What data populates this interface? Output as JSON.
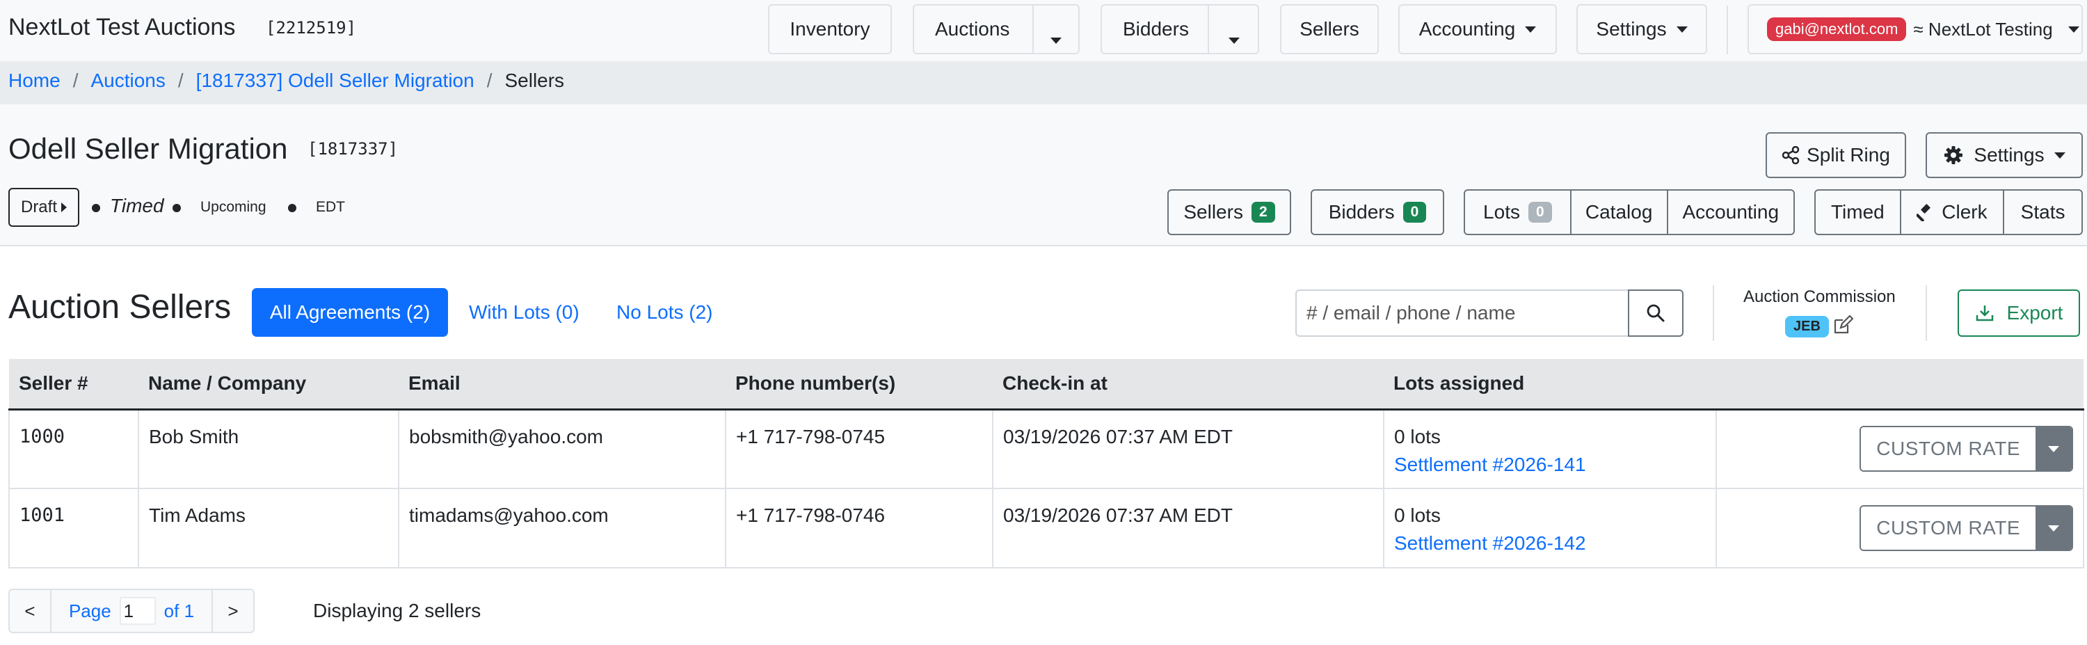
{
  "app": {
    "name": "NextLot Test Auctions",
    "id": "[2212519]"
  },
  "nav": {
    "inventory": "Inventory",
    "auctions": "Auctions",
    "bidders": "Bidders",
    "sellers": "Sellers",
    "accounting": "Accounting",
    "settings": "Settings",
    "user_email": "gabi@nextlot.com",
    "org": "≈ NextLot Testing"
  },
  "breadcrumb": {
    "home": "Home",
    "auctions": "Auctions",
    "auction": "[1817337] Odell Seller Migration",
    "current": "Sellers",
    "sep": "/"
  },
  "auction": {
    "title": "Odell Seller Migration",
    "id": "[1817337]",
    "state": "Draft",
    "format": "Timed",
    "phase": "Upcoming",
    "timezone": "EDT"
  },
  "header_actions": {
    "split_ring": "Split Ring",
    "settings": "Settings",
    "sellers": "Sellers",
    "sellers_count": "2",
    "bidders": "Bidders",
    "bidders_count": "0",
    "lots": "Lots",
    "lots_count": "0",
    "catalog": "Catalog",
    "accounting": "Accounting",
    "timed": "Timed",
    "clerk": "Clerk",
    "stats": "Stats"
  },
  "section": {
    "title": "Auction Sellers",
    "filters": {
      "all": "All Agreements (2)",
      "with_lots": "With Lots (0)",
      "no_lots": "No Lots (2)"
    },
    "search_placeholder": "# / email / phone / name",
    "commission_label": "Auction Commission",
    "commission_code": "JEB",
    "export": "Export"
  },
  "table": {
    "headers": [
      "Seller #",
      "Name / Company",
      "Email",
      "Phone number(s)",
      "Check-in at",
      "Lots assigned"
    ],
    "rows": [
      {
        "seller_no": "1000",
        "name": "Bob Smith",
        "email": "bobsmith@yahoo.com",
        "phone": "+1 717-798-0745",
        "checkin": "03/19/2026 07:37 AM EDT",
        "lots": "0 lots",
        "settlement": "Settlement #2026-141",
        "action": "CUSTOM RATE"
      },
      {
        "seller_no": "1001",
        "name": "Tim Adams",
        "email": "timadams@yahoo.com",
        "phone": "+1 717-798-0746",
        "checkin": "03/19/2026 07:37 AM EDT",
        "lots": "0 lots",
        "settlement": "Settlement #2026-142",
        "action": "CUSTOM RATE"
      }
    ]
  },
  "pager": {
    "prev": "<",
    "page_label": "Page",
    "page_value": "1",
    "of_label": "of 1",
    "next": ">",
    "summary": "Displaying 2 sellers"
  },
  "colors": {
    "primary": "#0d6efd",
    "success": "#198754",
    "danger": "#dc3545",
    "info": "#4fc3f7",
    "secondary": "#6c757d"
  }
}
